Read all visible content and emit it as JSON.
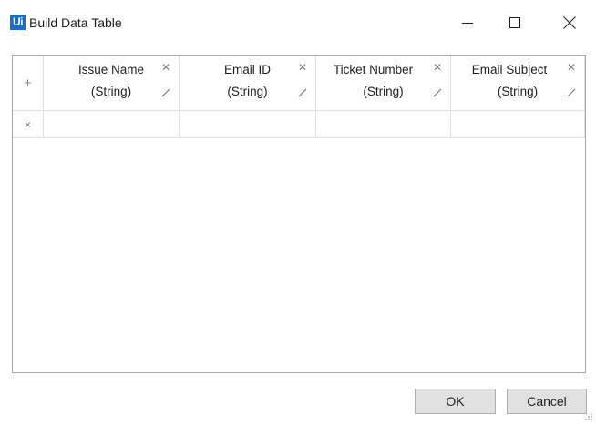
{
  "window": {
    "logo_text": "Ui",
    "title": "Build Data Table"
  },
  "grid": {
    "add_column_symbol": "+",
    "delete_row_symbol": "×",
    "columns": [
      {
        "name": "Issue Name",
        "type": "(String)"
      },
      {
        "name": "Email ID",
        "type": "(String)"
      },
      {
        "name": "Ticket Number",
        "type": "(String)"
      },
      {
        "name": "Email Subject",
        "type": "(String)"
      }
    ],
    "rows": [
      [
        "",
        "",
        "",
        ""
      ]
    ]
  },
  "footer": {
    "ok_label": "OK",
    "cancel_label": "Cancel"
  },
  "colors": {
    "logo_bg": "#1b6fc3",
    "grid_border": "#a9a9a9",
    "cell_border": "#e0e0e0",
    "button_bg": "#e1e1e1"
  },
  "icons": {
    "column_delete": "close-icon",
    "column_edit": "pencil-icon",
    "window_controls": [
      "minimize-icon",
      "maximize-icon",
      "close-icon"
    ]
  }
}
